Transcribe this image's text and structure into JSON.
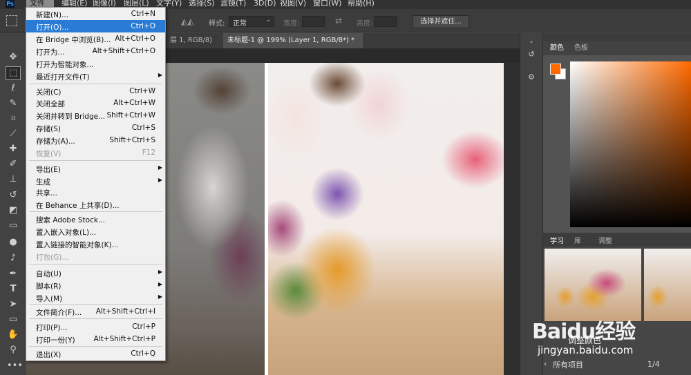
{
  "app": {
    "logo_text": "Ps"
  },
  "menubar": {
    "items": [
      "文件(F)",
      "编辑(E)",
      "图像(I)",
      "图层(L)",
      "文字(Y)",
      "选择(S)",
      "滤镜(T)",
      "3D(D)",
      "视图(V)",
      "窗口(W)",
      "帮助(H)"
    ]
  },
  "options": {
    "style_label": "样式:",
    "style_value": "正常",
    "width_label": "宽度:",
    "height_label": "高度:",
    "select_mask_button": "选择并遮住..."
  },
  "tabs": {
    "tab1": "层 1, RGB/8)",
    "tab2": "未标题-1 @ 199% (Layer 1, RGB/8*) *"
  },
  "file_menu": {
    "items": [
      {
        "label": "新建(N)...",
        "shortcut": "Ctrl+N"
      },
      {
        "label": "打开(O)...",
        "shortcut": "Ctrl+O",
        "selected": true
      },
      {
        "label": "在 Bridge 中浏览(B)...",
        "shortcut": "Alt+Ctrl+O"
      },
      {
        "label": "打开为...",
        "shortcut": "Alt+Shift+Ctrl+O"
      },
      {
        "label": "打开为智能对象...",
        "shortcut": ""
      },
      {
        "label": "最近打开文件(T)",
        "shortcut": "",
        "submenu": true
      },
      {
        "label": "关闭(C)",
        "shortcut": "Ctrl+W"
      },
      {
        "label": "关闭全部",
        "shortcut": "Alt+Ctrl+W"
      },
      {
        "label": "关闭并转到 Bridge...",
        "shortcut": "Shift+Ctrl+W"
      },
      {
        "label": "存储(S)",
        "shortcut": "Ctrl+S"
      },
      {
        "label": "存储为(A)...",
        "shortcut": "Shift+Ctrl+S"
      },
      {
        "label": "恢复(V)",
        "shortcut": "F12",
        "disabled": true
      },
      {
        "label": "导出(E)",
        "shortcut": "",
        "submenu": true
      },
      {
        "label": "生成",
        "shortcut": "",
        "submenu": true
      },
      {
        "label": "共享...",
        "shortcut": ""
      },
      {
        "label": "在 Behance 上共享(D)...",
        "shortcut": ""
      },
      {
        "label": "搜索 Adobe Stock...",
        "shortcut": ""
      },
      {
        "label": "置入嵌入对象(L)...",
        "shortcut": ""
      },
      {
        "label": "置入链接的智能对象(K)...",
        "shortcut": ""
      },
      {
        "label": "打包(G)...",
        "shortcut": "",
        "disabled": true
      },
      {
        "label": "自动(U)",
        "shortcut": "",
        "submenu": true
      },
      {
        "label": "脚本(R)",
        "shortcut": "",
        "submenu": true
      },
      {
        "label": "导入(M)",
        "shortcut": "",
        "submenu": true
      },
      {
        "label": "文件简介(F)...",
        "shortcut": "Alt+Shift+Ctrl+I"
      },
      {
        "label": "打印(P)...",
        "shortcut": "Ctrl+P"
      },
      {
        "label": "打印一份(Y)",
        "shortcut": "Alt+Shift+Ctrl+P"
      },
      {
        "label": "退出(X)",
        "shortcut": "Ctrl+Q"
      }
    ]
  },
  "color_panel": {
    "tab_color": "颜色",
    "tab_swatches": "色板",
    "foreground_color": "#ff6a00",
    "background_color": "#ffffff"
  },
  "learn_panel": {
    "tab_learn": "学习",
    "tab_libraries": "库",
    "tab_adjustments": "调整",
    "item_title": "调整颜色",
    "all_items": "所有项目",
    "page": "1/4"
  },
  "watermark": {
    "logo": "Baidu经验",
    "url": "jingyan.baidu.com"
  },
  "icons": [
    "move-icon",
    "marquee-icon",
    "lasso-icon",
    "quick-select-icon",
    "crop-icon",
    "eyedropper-icon",
    "healing-icon",
    "brush-icon",
    "stamp-icon",
    "history-brush-icon",
    "eraser-icon",
    "gradient-icon",
    "blur-icon",
    "dodge-icon",
    "pen-icon",
    "type-icon",
    "path-select-icon",
    "rectangle-icon",
    "hand-icon",
    "zoom-icon",
    "more-icon"
  ]
}
